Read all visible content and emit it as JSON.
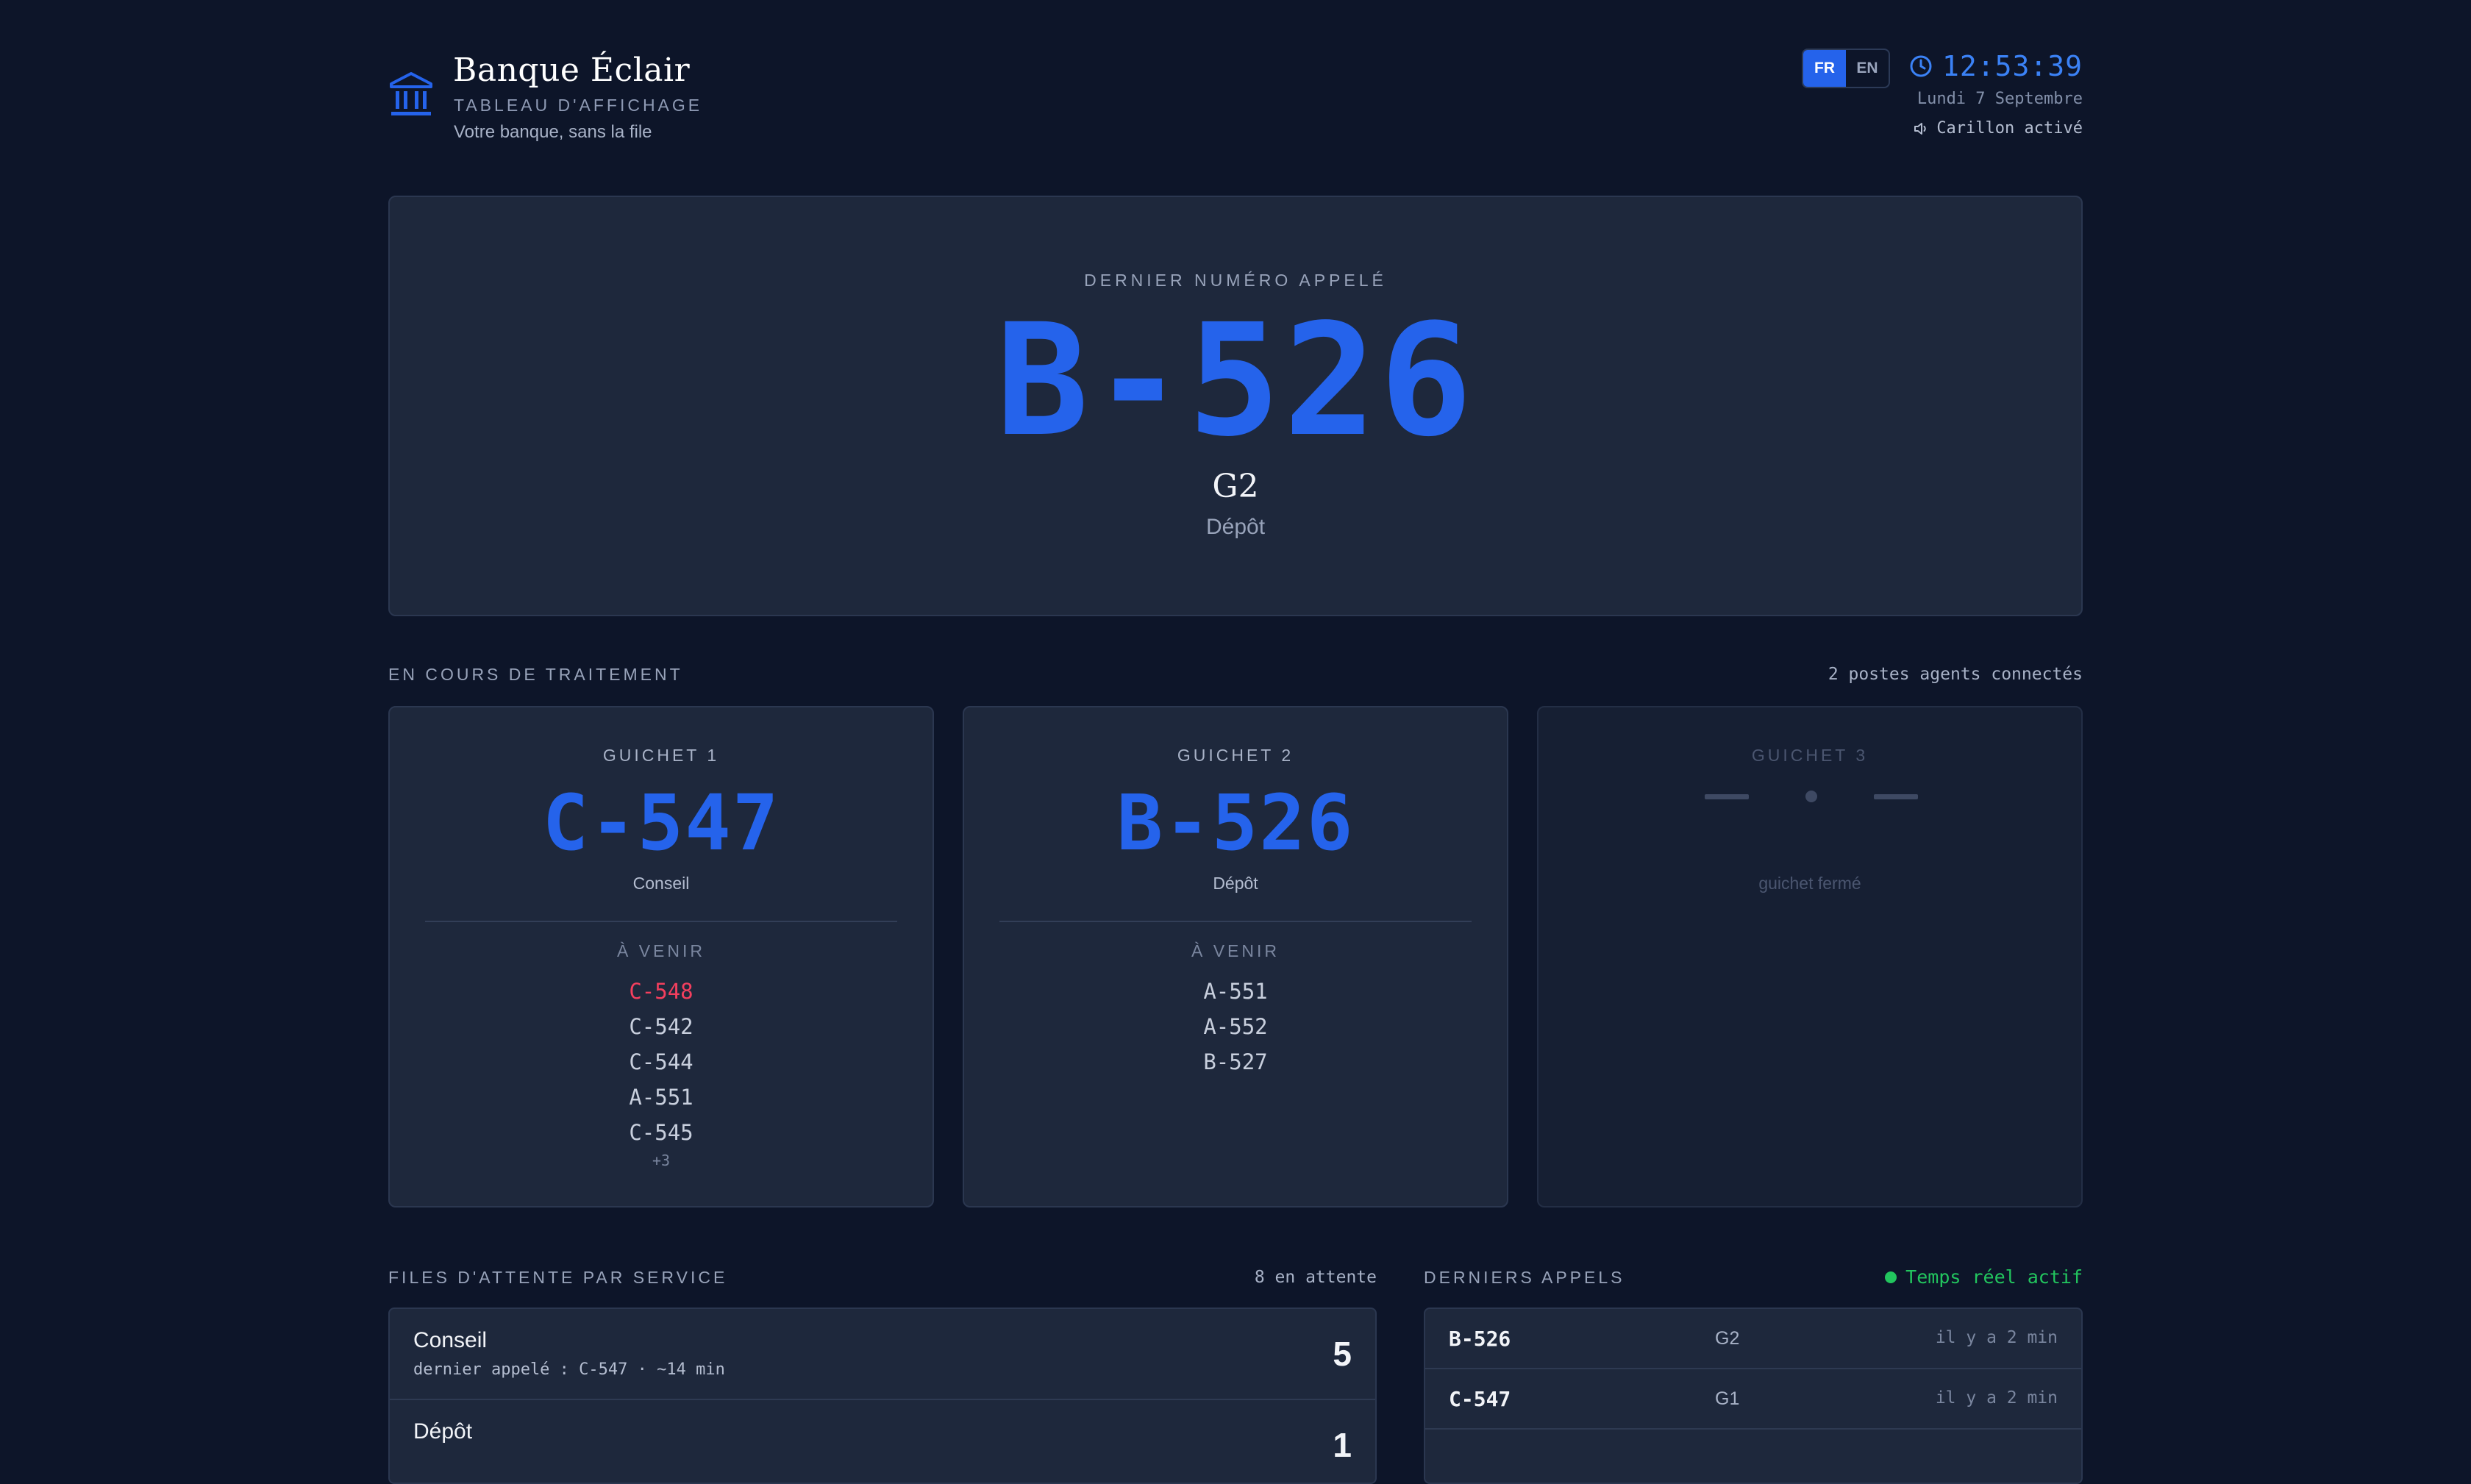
{
  "header": {
    "title": "Banque Éclair",
    "subtitle": "TABLEAU D'AFFICHAGE",
    "tagline": "Votre banque, sans la file",
    "languages": [
      {
        "label": "FR",
        "active": true
      },
      {
        "label": "EN",
        "active": false
      }
    ],
    "time": "12:53:39",
    "date": "Lundi 7 Septembre",
    "chime": "Carillon activé",
    "accent_color": "#2563eb"
  },
  "hero": {
    "label": "DERNIER NUMÉRO APPELÉ",
    "number": "B-526",
    "counter": "G2",
    "service": "Dépôt"
  },
  "processing": {
    "label": "EN COURS DE TRAITEMENT",
    "agents": "2 postes agents connectés",
    "counters": [
      {
        "label": "GUICHET 1",
        "number": "C-547",
        "service": "Conseil",
        "upcoming_label": "À VENIR",
        "upcoming": [
          "C-548",
          "C-542",
          "C-544",
          "A-551",
          "C-545"
        ],
        "more": "+3"
      },
      {
        "label": "GUICHET 2",
        "number": "B-526",
        "service": "Dépôt",
        "upcoming_label": "À VENIR",
        "upcoming": [
          "A-551",
          "A-552",
          "B-527"
        ]
      },
      {
        "label": "GUICHET 3",
        "status": "guichet fermé"
      }
    ]
  },
  "queues": {
    "label": "FILES D'ATTENTE PAR SERVICE",
    "total": "8 en attente",
    "items": [
      {
        "name": "Conseil",
        "meta": "dernier appelé : C-547 · ~14 min",
        "count": "5"
      },
      {
        "name": "Dépôt",
        "count": "1"
      }
    ]
  },
  "calls": {
    "label": "DERNIERS APPELS",
    "live": "Temps réel actif",
    "live_color": "#22c55e",
    "items": [
      {
        "number": "B-526",
        "counter": "G2",
        "time": "il y a 2 min"
      },
      {
        "number": "C-547",
        "counter": "G1",
        "time": "il y a 2 min"
      }
    ]
  }
}
